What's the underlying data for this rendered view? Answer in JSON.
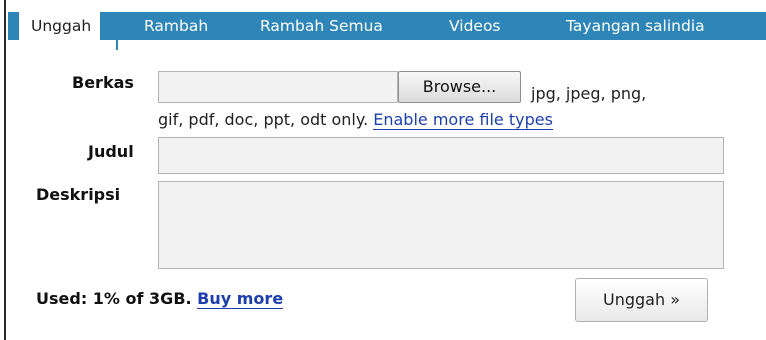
{
  "tabs": [
    {
      "label": "Unggah",
      "active": true
    },
    {
      "label": "Rambah"
    },
    {
      "label": "Rambah Semua"
    },
    {
      "label": "Videos"
    },
    {
      "label": "Tayangan salindia"
    }
  ],
  "form": {
    "file_label": "Berkas",
    "browse_label": "Browse...",
    "file_types_line1": "jpg, jpeg, png,",
    "file_types_line2": "gif, pdf, doc, ppt, odt only.",
    "enable_more_label": "Enable more file types",
    "title_label": "Judul",
    "title_value": "",
    "description_label": "Deskripsi",
    "description_value": ""
  },
  "footer": {
    "usage_text": "Used: 1% of 3GB.",
    "buy_more_label": "Buy more",
    "submit_label": "Unggah »"
  },
  "colors": {
    "tab_bar": "#2e86b8",
    "link": "#1d3fae"
  }
}
